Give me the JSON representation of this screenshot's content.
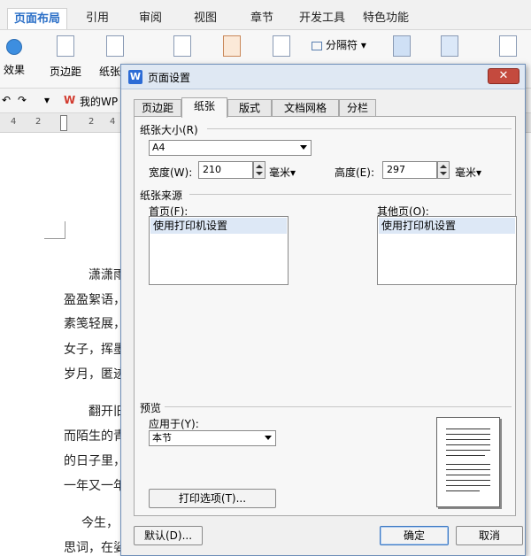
{
  "ribbon": {
    "tabs": [
      "页面布局",
      "引用",
      "审阅",
      "视图",
      "章节",
      "开发工具",
      "特色功能"
    ],
    "active_tab": "页面布局",
    "items": [
      "效果",
      "页边距",
      "纸张方",
      "分隔符"
    ]
  },
  "quickbar": {
    "doc_tab": "我的WP"
  },
  "ruler": {
    "numbers": [
      "4",
      "2",
      "2",
      "4"
    ]
  },
  "document": {
    "lines": [
      "潇潇雨",
      "盈盈絮语，",
      "素笺轻展，",
      "女子，挥墨",
      "岁月，匿迹",
      "翻开旧",
      "而陌生的青",
      "的日子里，",
      "一年又一年",
      "今生，",
      "思词，在娑"
    ]
  },
  "dialog": {
    "title": "页面设置",
    "close_label": "✕",
    "tabs": [
      "页边距",
      "纸张",
      "版式",
      "文档网格",
      "分栏"
    ],
    "active_tab": "纸张",
    "paper_size": {
      "group_title": "纸张大小(R)",
      "size_value": "A4",
      "width_label": "宽度(W):",
      "width_value": "210",
      "width_unit": "毫米",
      "height_label": "高度(E):",
      "height_value": "297",
      "height_unit": "毫米"
    },
    "paper_source": {
      "group_title": "纸张来源",
      "first_page_label": "首页(F):",
      "first_page_item": "使用打印机设置",
      "other_pages_label": "其他页(O):",
      "other_pages_item": "使用打印机设置"
    },
    "preview": {
      "group_title": "预览",
      "apply_label": "应用于(Y):",
      "apply_value": "本节"
    },
    "print_options_button": "打印选项(T)...",
    "default_button": "默认(D)...",
    "ok_button": "确定",
    "cancel_button": "取消"
  }
}
